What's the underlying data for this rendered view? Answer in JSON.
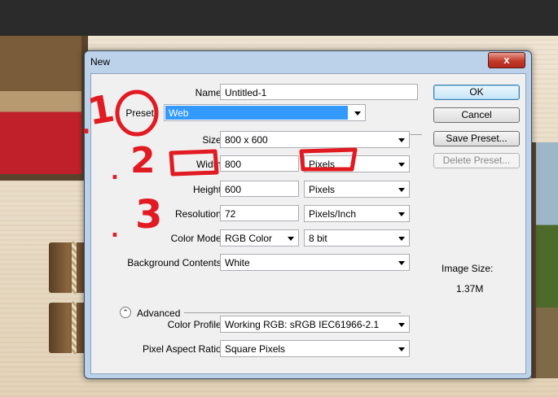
{
  "dialog": {
    "title": "New",
    "close_glyph": "x",
    "fields": {
      "name": {
        "label": "Name:",
        "value": "Untitled-1"
      },
      "preset": {
        "label": "Preset",
        "value": "Web"
      },
      "size": {
        "label": "Size:",
        "value": "800 x 600"
      },
      "width": {
        "label": "Width:",
        "value": "800",
        "unit": "Pixels"
      },
      "height": {
        "label": "Height:",
        "value": "600",
        "unit": "Pixels"
      },
      "resolution": {
        "label": "Resolution:",
        "value": "72",
        "unit": "Pixels/Inch"
      },
      "color_mode": {
        "label": "Color Mode:",
        "value": "RGB Color",
        "depth": "8 bit"
      },
      "background": {
        "label": "Background Contents:",
        "value": "White"
      },
      "color_profile": {
        "label": "Color Profile:",
        "value": "Working RGB:  sRGB IEC61966-2.1"
      },
      "pixel_aspect": {
        "label": "Pixel Aspect Ratio:",
        "value": "Square Pixels"
      }
    },
    "advanced_label": "Advanced",
    "advanced_glyph": "⌃",
    "buttons": {
      "ok": "OK",
      "cancel": "Cancel",
      "save_preset": "Save Preset...",
      "delete_preset": "Delete Preset..."
    },
    "image_size": {
      "label": "Image Size:",
      "value": "1.37M"
    }
  },
  "annotations": {
    "one": "1",
    "two": "2",
    "three": "3",
    "dot": "."
  },
  "colors": {
    "annotation": "#e21a22",
    "preset_highlight": "#3399ff",
    "title_bar": "#bcd2ea"
  }
}
